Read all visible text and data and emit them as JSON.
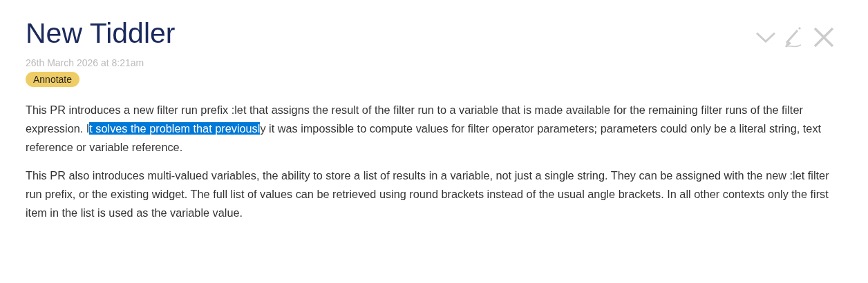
{
  "tiddler": {
    "title": "New Tiddler",
    "subtitle": "26th March 2026 at 8:21am",
    "tags": [
      {
        "label": "Annotate",
        "color": "#efcd66"
      }
    ],
    "paragraphs": [
      {
        "segments": [
          {
            "text": "This PR introduces a new filter run prefix :let that assigns the result of the filter run to a variable that is made available for the remaining filter runs of the filter expression. I",
            "selected": false
          },
          {
            "text": "t solves the problem that previousl",
            "selected": true
          },
          {
            "text": "y it was impossible to compute values for filter operator parameters; parameters could only be a literal string, text reference or variable reference.",
            "selected": false
          }
        ]
      },
      {
        "segments": [
          {
            "text": "This PR also introduces multi-valued variables, the ability to store a list of results in a variable, not just a single string. They can be assigned with the new :let filter run prefix, or the existing widget. The full list of values can be retrieved using round brackets instead of the usual angle brackets. In all other contexts only the first item in the list is used as the variable value.",
            "selected": false
          }
        ]
      }
    ]
  }
}
